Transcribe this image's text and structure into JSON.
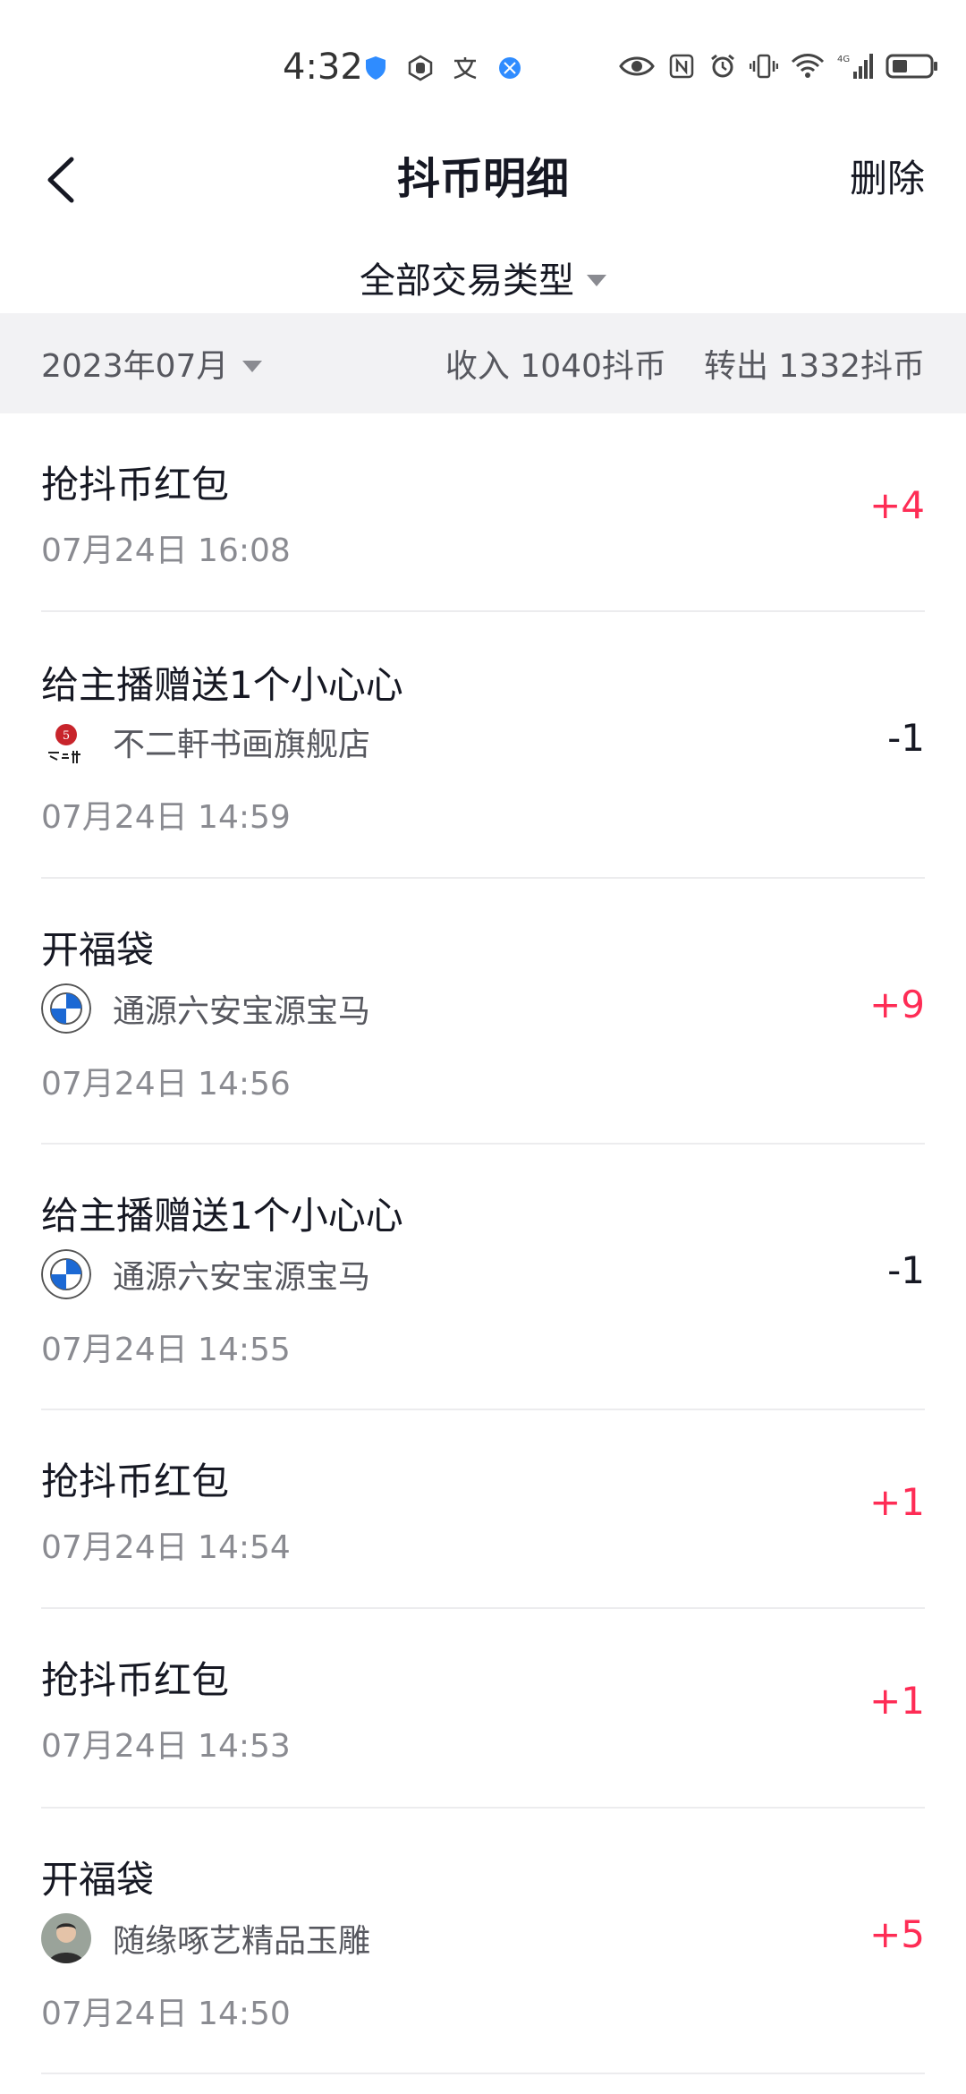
{
  "status_bar": {
    "time": "4:32",
    "left_icons": [
      "shield-icon",
      "hand-icon",
      "translate-icon",
      "globe-icon"
    ],
    "right_icons": [
      "eye-icon",
      "nfc-icon",
      "alarm-icon",
      "vibrate-icon",
      "wifi-icon",
      "signal-4g-icon",
      "battery-icon"
    ]
  },
  "header": {
    "title": "抖币明细",
    "right_action": "删除"
  },
  "filter": {
    "label": "全部交易类型"
  },
  "month_bar": {
    "month": "2023年07月",
    "income": "收入 1040抖币",
    "outgoing": "转出 1332抖币"
  },
  "transactions": [
    {
      "title": "抢抖币红包",
      "time": "07月24日 16:08",
      "amount": "+4",
      "type": "positive"
    },
    {
      "title": "给主播赠送1个小心心",
      "streamer": "不二軒书画旗舰店",
      "time": "07月24日 14:59",
      "amount": "-1",
      "type": "negative",
      "avatar": "bu-er-xuan-logo"
    },
    {
      "title": "开福袋",
      "streamer": "通源六安宝源宝马",
      "time": "07月24日 14:56",
      "amount": "+9",
      "type": "positive",
      "avatar": "bmw-logo"
    },
    {
      "title": "给主播赠送1个小心心",
      "streamer": "通源六安宝源宝马",
      "time": "07月24日 14:55",
      "amount": "-1",
      "type": "negative",
      "avatar": "bmw-logo"
    },
    {
      "title": "抢抖币红包",
      "time": "07月24日 14:54",
      "amount": "+1",
      "type": "positive"
    },
    {
      "title": "抢抖币红包",
      "time": "07月24日 14:53",
      "amount": "+1",
      "type": "positive"
    },
    {
      "title": "开福袋",
      "streamer": "随缘啄艺精品玉雕",
      "time": "07月24日 14:50",
      "amount": "+5",
      "type": "positive",
      "avatar": "person-photo"
    }
  ],
  "colors": {
    "positive": "#fe2c55",
    "negative": "#161823",
    "bar_bg": "#f2f2f4"
  }
}
